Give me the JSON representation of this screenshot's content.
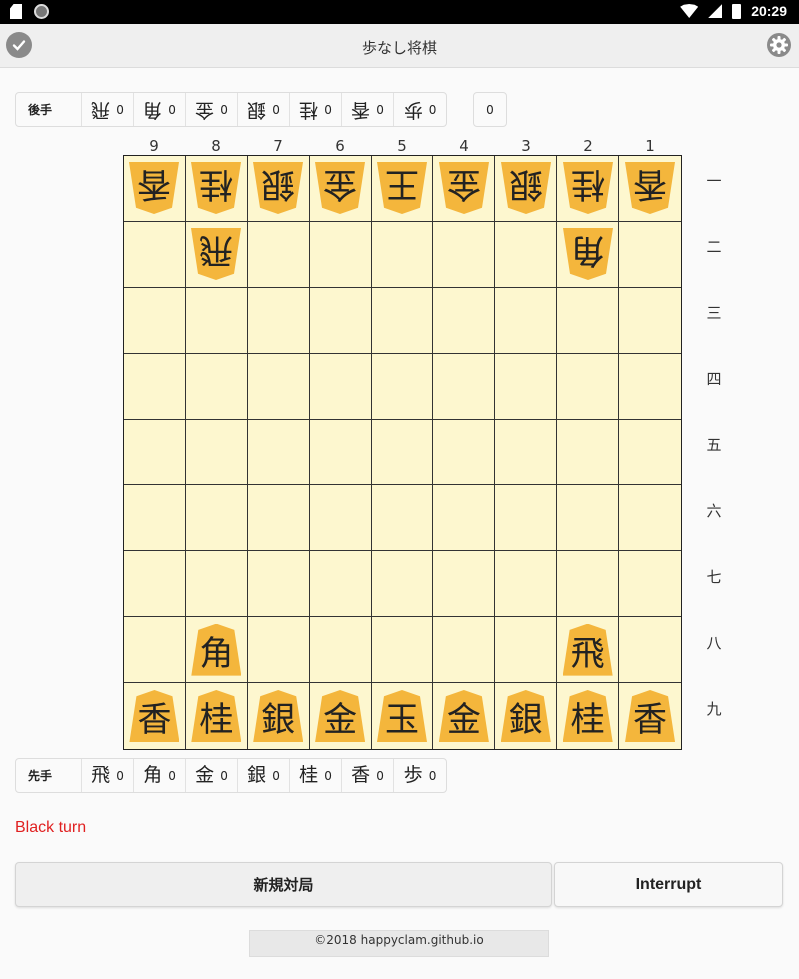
{
  "statusbar": {
    "time": "20:29"
  },
  "app": {
    "title": "歩なし将棋"
  },
  "gote_hand": {
    "label": "後手",
    "items": [
      {
        "piece": "飛",
        "count": "0"
      },
      {
        "piece": "角",
        "count": "0"
      },
      {
        "piece": "金",
        "count": "0"
      },
      {
        "piece": "銀",
        "count": "0"
      },
      {
        "piece": "桂",
        "count": "0"
      },
      {
        "piece": "香",
        "count": "0"
      },
      {
        "piece": "歩",
        "count": "0"
      }
    ],
    "extra_count": "0"
  },
  "sente_hand": {
    "label": "先手",
    "items": [
      {
        "piece": "飛",
        "count": "0"
      },
      {
        "piece": "角",
        "count": "0"
      },
      {
        "piece": "金",
        "count": "0"
      },
      {
        "piece": "銀",
        "count": "0"
      },
      {
        "piece": "桂",
        "count": "0"
      },
      {
        "piece": "香",
        "count": "0"
      },
      {
        "piece": "歩",
        "count": "0"
      }
    ]
  },
  "board": {
    "files": [
      "9",
      "8",
      "7",
      "6",
      "5",
      "4",
      "3",
      "2",
      "1"
    ],
    "ranks": [
      "一",
      "二",
      "三",
      "四",
      "五",
      "六",
      "七",
      "八",
      "九"
    ],
    "rows": [
      [
        {
          "p": "香",
          "o": "gote"
        },
        {
          "p": "桂",
          "o": "gote"
        },
        {
          "p": "銀",
          "o": "gote"
        },
        {
          "p": "金",
          "o": "gote"
        },
        {
          "p": "王",
          "o": "gote"
        },
        {
          "p": "金",
          "o": "gote"
        },
        {
          "p": "銀",
          "o": "gote"
        },
        {
          "p": "桂",
          "o": "gote"
        },
        {
          "p": "香",
          "o": "gote"
        }
      ],
      [
        null,
        {
          "p": "飛",
          "o": "gote"
        },
        null,
        null,
        null,
        null,
        null,
        {
          "p": "角",
          "o": "gote"
        },
        null
      ],
      [
        null,
        null,
        null,
        null,
        null,
        null,
        null,
        null,
        null
      ],
      [
        null,
        null,
        null,
        null,
        null,
        null,
        null,
        null,
        null
      ],
      [
        null,
        null,
        null,
        null,
        null,
        null,
        null,
        null,
        null
      ],
      [
        null,
        null,
        null,
        null,
        null,
        null,
        null,
        null,
        null
      ],
      [
        null,
        null,
        null,
        null,
        null,
        null,
        null,
        null,
        null
      ],
      [
        null,
        {
          "p": "角",
          "o": "sente"
        },
        null,
        null,
        null,
        null,
        null,
        {
          "p": "飛",
          "o": "sente"
        },
        null
      ],
      [
        {
          "p": "香",
          "o": "sente"
        },
        {
          "p": "桂",
          "o": "sente"
        },
        {
          "p": "銀",
          "o": "sente"
        },
        {
          "p": "金",
          "o": "sente"
        },
        {
          "p": "玉",
          "o": "sente"
        },
        {
          "p": "金",
          "o": "sente"
        },
        {
          "p": "銀",
          "o": "sente"
        },
        {
          "p": "桂",
          "o": "sente"
        },
        {
          "p": "香",
          "o": "sente"
        }
      ]
    ]
  },
  "status": {
    "turn": "Black turn",
    "turn_color": "#e02020"
  },
  "buttons": {
    "new_game": "新規対局",
    "interrupt": "Interrupt"
  },
  "footer": "©2018 happyclam.github.io"
}
